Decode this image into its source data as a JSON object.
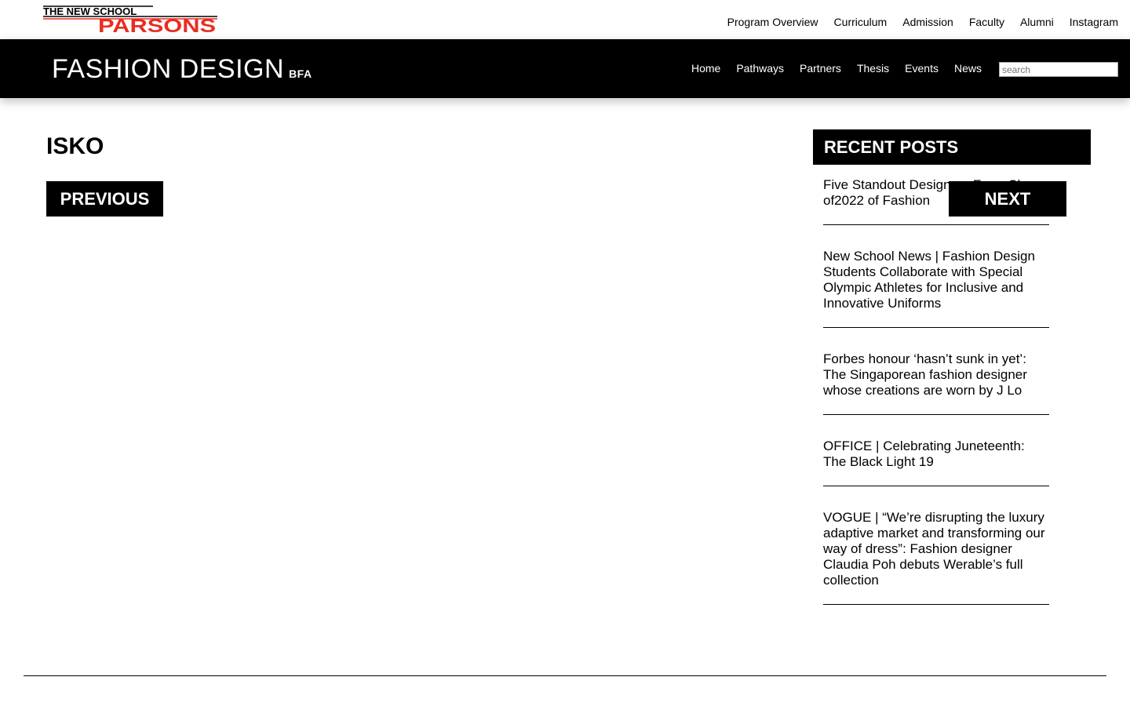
{
  "header": {
    "logo": {
      "line1": "THE NEW SCHOOL",
      "line2": "PARSONS",
      "brand_red": "#e82e21"
    },
    "utility_nav": [
      "Program Overview",
      "Curriculum",
      "Admission",
      "Faculty",
      "Alumni",
      "Instagram"
    ],
    "site_title": "FASHION DESIGN",
    "site_title_suffix": "BFA",
    "main_nav": [
      "Home",
      "Pathways",
      "Partners",
      "Thesis",
      "Events",
      "News"
    ],
    "search": {
      "placeholder": "search",
      "value": ""
    }
  },
  "main": {
    "title": "ISKO",
    "previous_label": "PREVIOUS",
    "next_label": "NEXT"
  },
  "sidebar": {
    "heading": "RECENT POSTS",
    "posts": [
      "Five Standout Designers From Class of2022 of Fashion",
      "New School News | Fashion Design Students Collaborate with Special Olympic Athletes for Inclusive and Innovative Uniforms",
      "Forbes honour ‘hasn’t sunk in yet’: The Singaporean fashion designer whose creations are worn by J Lo",
      "OFFICE | Celebrating Juneteenth: The Black Light 19",
      "VOGUE | “We’re disrupting the luxury adaptive market and transforming our way of dress”: Fashion designer Claudia Poh debuts Werable’s full collection"
    ]
  },
  "colors": {
    "black": "#000000",
    "white": "#ffffff",
    "brand_red": "#e82e21"
  }
}
